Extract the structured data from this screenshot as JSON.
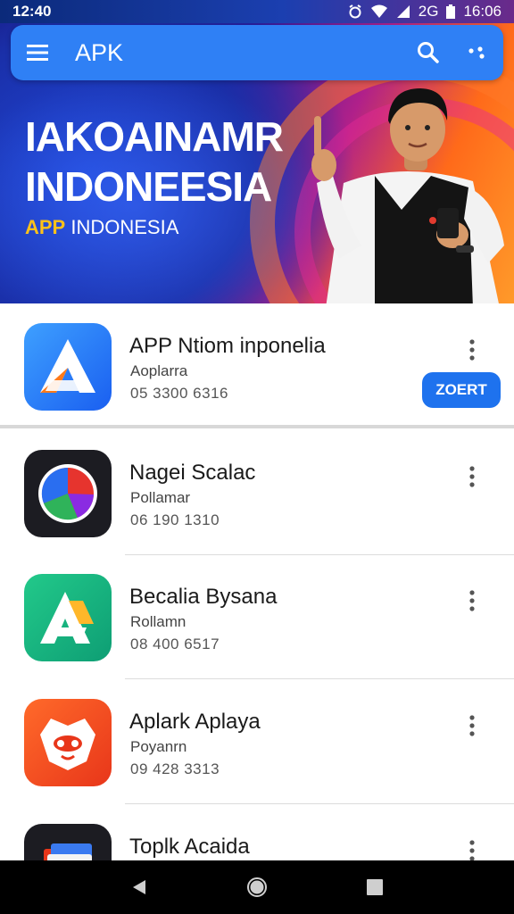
{
  "status_bar": {
    "time": "12:40",
    "battery_label": "2G",
    "clock": "16:06"
  },
  "app_bar": {
    "title": "APK",
    "icons": [
      "menu-icon",
      "search-icon",
      "more-icon"
    ]
  },
  "hero": {
    "title_line1": "IAKOAINAMR",
    "title_line2": "INDONEESIA",
    "subtitle_highlight": "APP",
    "subtitle_rest": " INDONESIA",
    "colors": {
      "deep_blue": "#160f70",
      "blue": "#1f46d6",
      "magenta": "#b0208a",
      "orange": "#ff6a1a",
      "accent_yellow": "#ffc21a"
    }
  },
  "apps": [
    {
      "name": "APP Ntiom inponelia",
      "developer": "Aoplarra",
      "meta": "05 3300 6316",
      "icon": "app-a-icon",
      "action": "ZOERT"
    },
    {
      "name": "Nagei Scalac",
      "developer": "Pollamar",
      "meta": "06 190 1310",
      "icon": "color-wheel-icon"
    },
    {
      "name": "Becalia Bysana",
      "developer": "Rollamn",
      "meta": "08 400 6517",
      "icon": "green-a-icon"
    },
    {
      "name": "Aplark Aplaya",
      "developer": "Poyanrn",
      "meta": "09 428 3313",
      "icon": "mascot-icon"
    },
    {
      "name": "Toplk Acaida",
      "developer": "",
      "meta": "",
      "icon": "folder-icon"
    }
  ],
  "colors": {
    "primary": "#2f80f5",
    "button": "#1e72ee"
  },
  "nav_bar": {
    "icons": [
      "back-icon",
      "home-icon",
      "recents-icon"
    ]
  }
}
